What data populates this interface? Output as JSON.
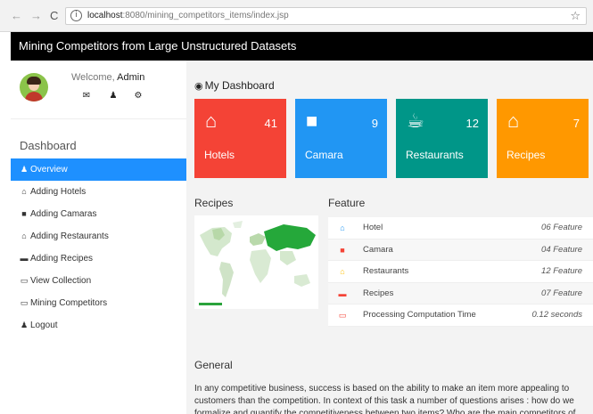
{
  "browser": {
    "back_icon": "←",
    "forward_icon": "→",
    "reload_icon": "C",
    "info_icon": "i",
    "url_host": "localhost",
    "url_path": ":8080/mining_competitors_items/index.jsp",
    "star_icon": "☆"
  },
  "app": {
    "title": "Mining Competitors from Large Unstructured Datasets"
  },
  "profile": {
    "welcome_prefix": "Welcome,",
    "username": "Admin",
    "mail_icon": "✉",
    "user_icon": "♟",
    "settings_icon": "⚙"
  },
  "sidebar": {
    "heading": "Dashboard",
    "items": [
      {
        "icon": "♟",
        "label": "Overview",
        "active": true
      },
      {
        "icon": "⌂",
        "label": "Adding Hotels"
      },
      {
        "icon": "■",
        "label": "Adding Camaras"
      },
      {
        "icon": "⌂",
        "label": "Adding Restaurants"
      },
      {
        "icon": "▬",
        "label": "Adding Recipes"
      },
      {
        "icon": "▭",
        "label": "View Collection"
      },
      {
        "icon": "▭",
        "label": "Mining Competitors"
      },
      {
        "icon": "♟",
        "label": "Logout"
      }
    ]
  },
  "dashboard": {
    "icon": "◉",
    "title": "My Dashboard",
    "tiles": [
      {
        "label": "Hotels",
        "count": "41",
        "icon": "⌂",
        "color": "#f44336"
      },
      {
        "label": "Camara",
        "count": "9",
        "icon": "■",
        "color": "#2196f3"
      },
      {
        "label": "Restaurants",
        "count": "12",
        "icon": "☕",
        "color": "#009688"
      },
      {
        "label": "Recipes",
        "count": "7",
        "icon": "⌂",
        "color": "#ff9800"
      }
    ]
  },
  "recipes": {
    "title": "Recipes"
  },
  "feature": {
    "title": "Feature",
    "rows": [
      {
        "icon": "⌂",
        "color": "#2196f3",
        "name": "Hotel",
        "value": "06 Feature"
      },
      {
        "icon": "■",
        "color": "#f44336",
        "name": "Camara",
        "value": "04 Feature"
      },
      {
        "icon": "⌂",
        "color": "#ffc107",
        "name": "Restaurants",
        "value": "12 Feature"
      },
      {
        "icon": "▬",
        "color": "#f44336",
        "name": "Recipes",
        "value": "07 Feature"
      },
      {
        "icon": "▭",
        "color": "#f44336",
        "name": "Processing Computation Time",
        "value": "0.12 seconds"
      }
    ]
  },
  "general": {
    "title": "General",
    "text": "In any competitive business, success is based on the ability to make an item more appealing to customers than the competition. In context of this task a number of questions arises : how do we formalize and quantify the competitiveness between two items? Who are the main competitors of"
  }
}
